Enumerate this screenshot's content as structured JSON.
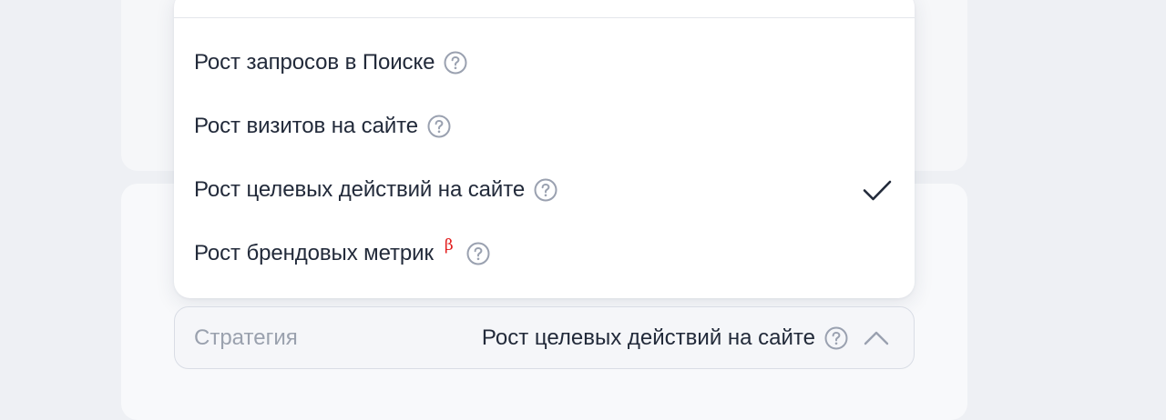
{
  "dropdown": {
    "options": [
      {
        "label": "Рост запросов в Поиске",
        "selected": false,
        "beta": false
      },
      {
        "label": "Рост визитов на сайте",
        "selected": false,
        "beta": false
      },
      {
        "label": "Рост целевых действий на сайте",
        "selected": true,
        "beta": false
      },
      {
        "label": "Рост брендовых метрик",
        "selected": false,
        "beta": true,
        "beta_mark": "β"
      }
    ]
  },
  "strategy_field": {
    "label": "Стратегия",
    "value": "Рост целевых действий на сайте",
    "expanded": true
  },
  "icons": {
    "help": "question-circle-icon",
    "check": "checkmark-icon",
    "chevron": "chevron-up-icon"
  },
  "colors": {
    "text": "#222a3a",
    "muted": "#9aa1ae",
    "beta": "#e21b1b",
    "icon": "#9aa1b0"
  }
}
